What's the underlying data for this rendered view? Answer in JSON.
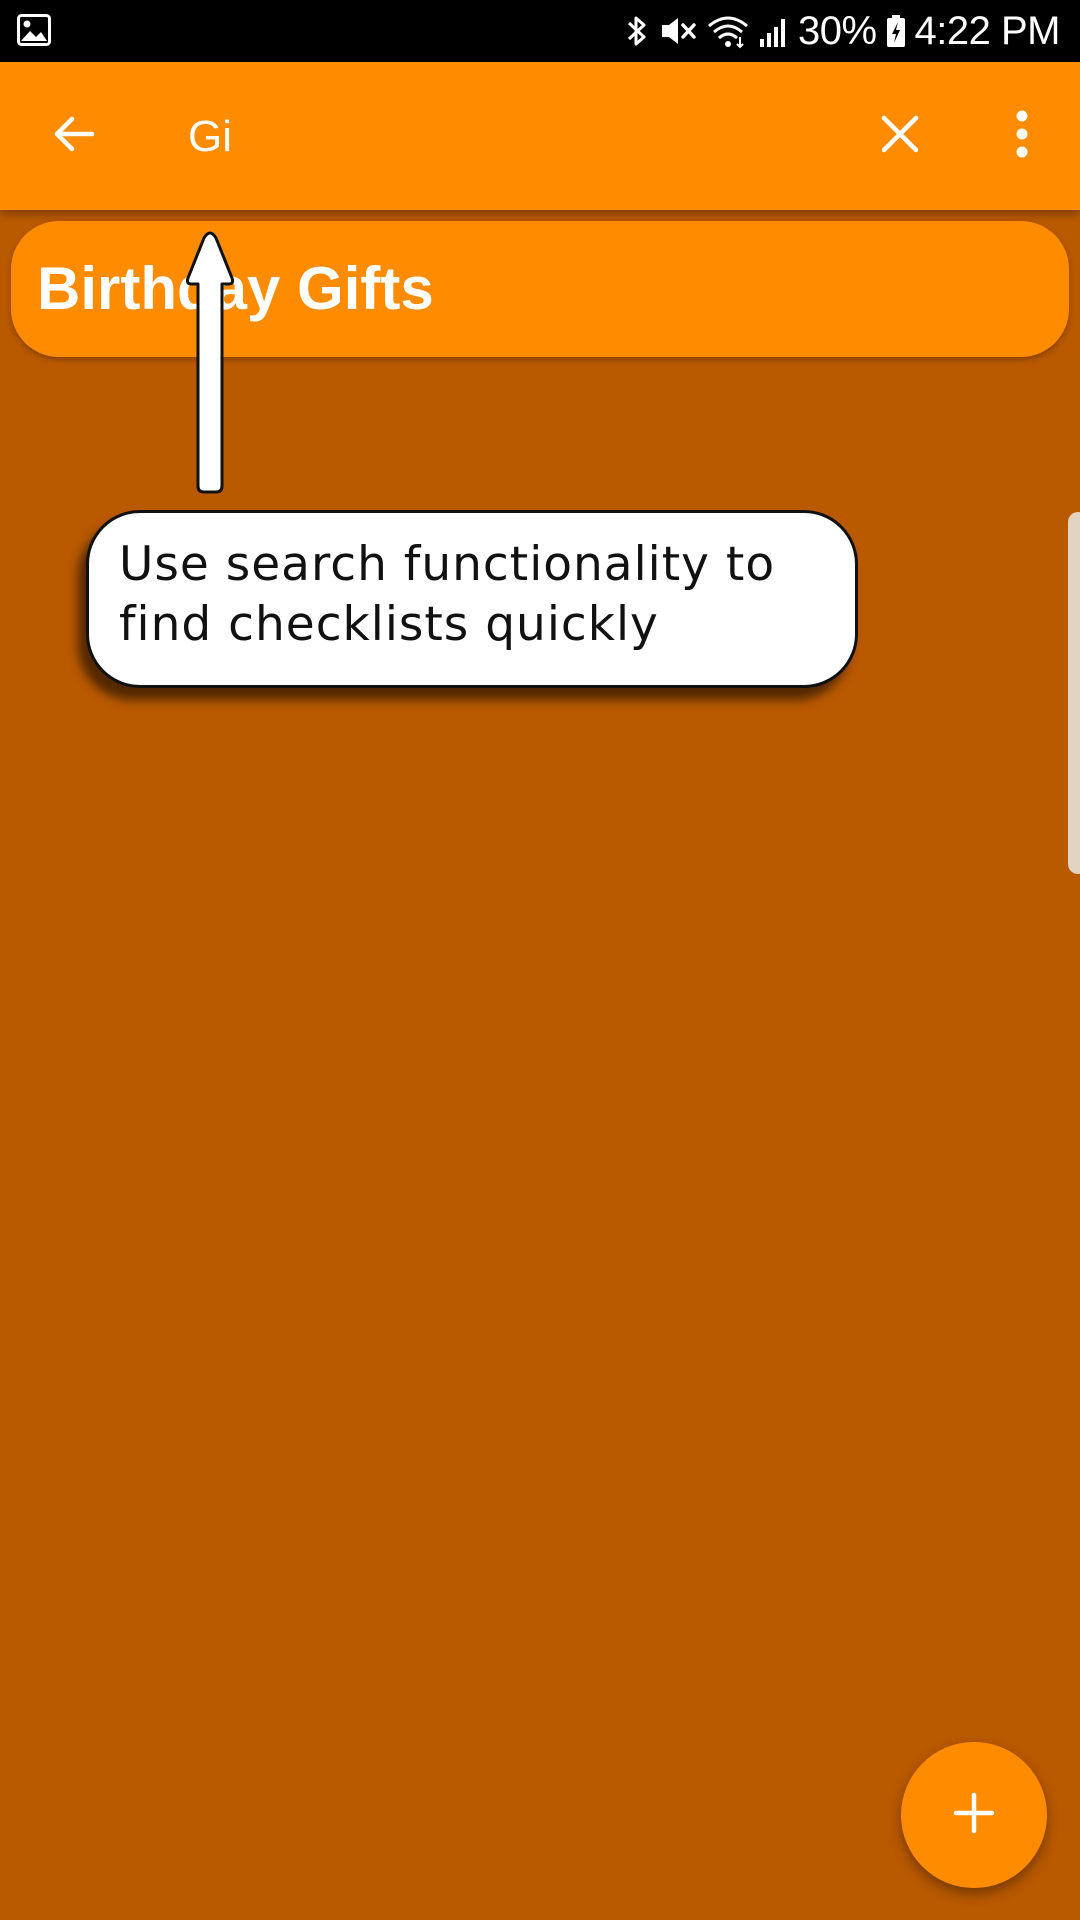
{
  "status_bar": {
    "left_icon": "gallery-notification-icon",
    "icons": [
      "bluetooth-icon",
      "vibrate-mute-icon",
      "wifi-icon",
      "signal-icon",
      "battery-charging-icon"
    ],
    "battery_percent": "30%",
    "time": "4:22 PM"
  },
  "app_bar": {
    "back_icon": "arrow-back-icon",
    "search_value": "Gi",
    "clear_icon": "close-icon",
    "overflow_icon": "more-vert-icon",
    "color": "#FF8C00"
  },
  "checklists": [
    {
      "title": "Birthday Gifts"
    }
  ],
  "tutorial": {
    "text": "Use search functionality to find checklists quickly",
    "pointer_icon": "up-arrow-icon"
  },
  "fab": {
    "icon": "plus-icon"
  },
  "colors": {
    "accent": "#FF8C00",
    "background_dimmed": "#B95900",
    "status_bar": "#000000",
    "tooltip_bg": "#FFFFFF"
  }
}
